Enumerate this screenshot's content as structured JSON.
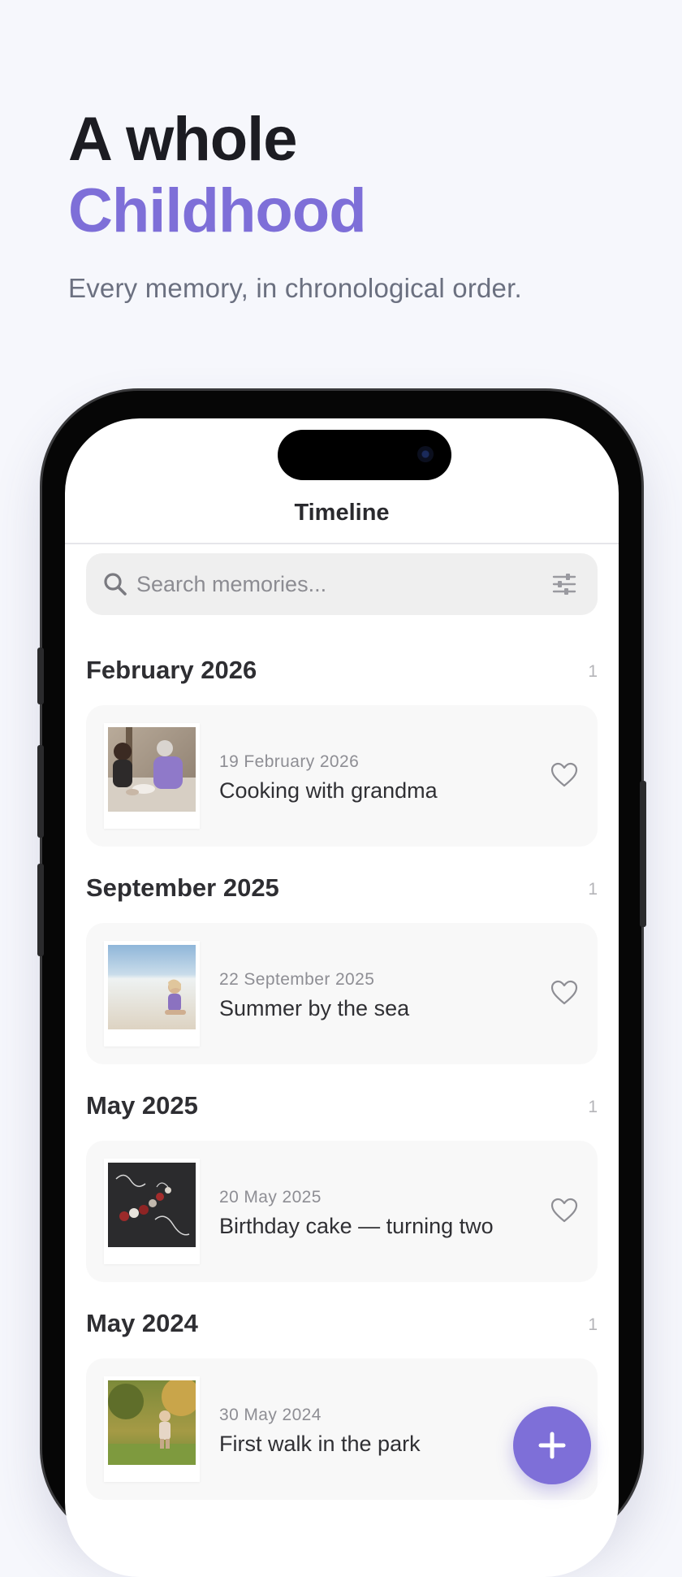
{
  "hero": {
    "title_line1": "A whole",
    "title_line2": "Childhood",
    "subtitle": "Every memory, in chronological order."
  },
  "app": {
    "nav_title": "Timeline",
    "search": {
      "placeholder": "Search memories..."
    },
    "sections": [
      {
        "title": "February 2026",
        "count": "1",
        "entry": {
          "date": "19 February 2026",
          "title": "Cooking with grandma"
        }
      },
      {
        "title": "September 2025",
        "count": "1",
        "entry": {
          "date": "22 September 2025",
          "title": "Summer by the sea"
        }
      },
      {
        "title": "May 2025",
        "count": "1",
        "entry": {
          "date": "20 May 2025",
          "title": "Birthday cake — turning two"
        }
      },
      {
        "title": "May 2024",
        "count": "1",
        "entry": {
          "date": "30 May 2024",
          "title": "First walk in the park"
        }
      }
    ]
  },
  "icons": {
    "search": "search-icon",
    "filter": "sliders-icon",
    "favorite": "heart-outline-icon",
    "add": "plus-icon"
  },
  "colors": {
    "accent": "#7e6fd8",
    "background": "#f6f7fc",
    "heading": "#1c1c22",
    "subtitle": "#6b7080"
  }
}
